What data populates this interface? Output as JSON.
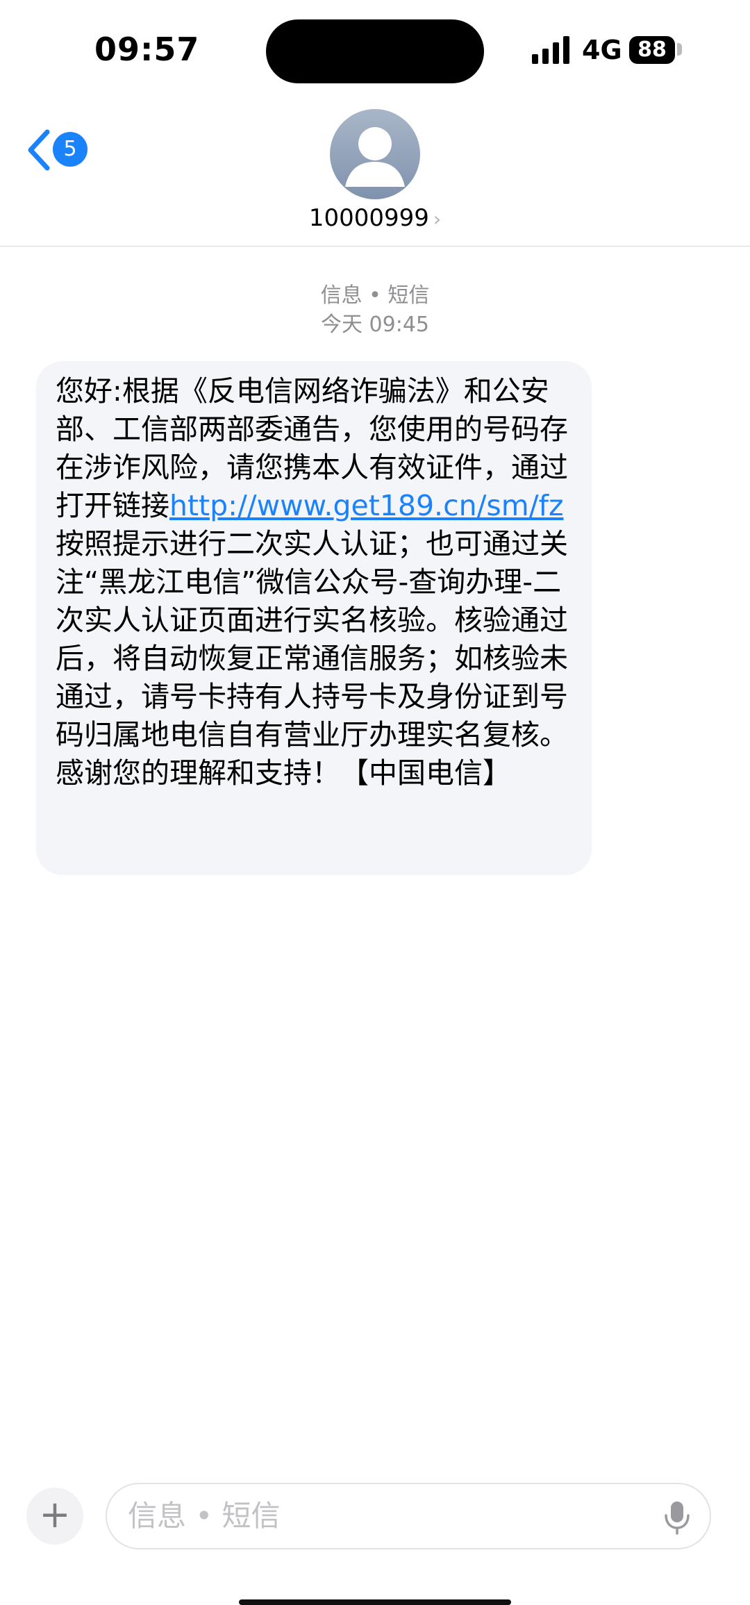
{
  "status_bar": {
    "time": "09:57",
    "network": "4G",
    "battery": "88"
  },
  "header": {
    "back_badge": "5",
    "contact_name": "10000999",
    "contact_chevron": "›"
  },
  "meta": {
    "service": "信息 • 短信",
    "timestamp": "今天 09:45"
  },
  "message": {
    "text_before_link": "您好:根据《反电信网络诈骗法》和公安部、工信部两部委通告，您使用的号码存在涉诈风险，请您携本人有效证件，通过打开链接",
    "link": "http://www.get189.cn/sm/fz",
    "text_after_link": " 按照提示进行二次实人认证；也可通过关注“黑龙江电信”微信公众号-查询办理-二次实人认证页面进行实名核验。核验通过后，将自动恢复正常通信服务；如核验未通过，请号卡持有人持号卡及身份证到号码归属地电信自有营业厅办理实名复核。感谢您的理解和支持！【中国电信】"
  },
  "composer": {
    "plus_label": "+",
    "placeholder": "信息 • 短信"
  },
  "icons": [
    "signal-icon",
    "battery-icon",
    "back-chevron-icon",
    "avatar-person-icon",
    "plus-icon",
    "mic-icon"
  ],
  "colors": {
    "accent": "#1a82fb",
    "bubble": "#f4f5f9",
    "meta_text": "#8e8e93"
  }
}
